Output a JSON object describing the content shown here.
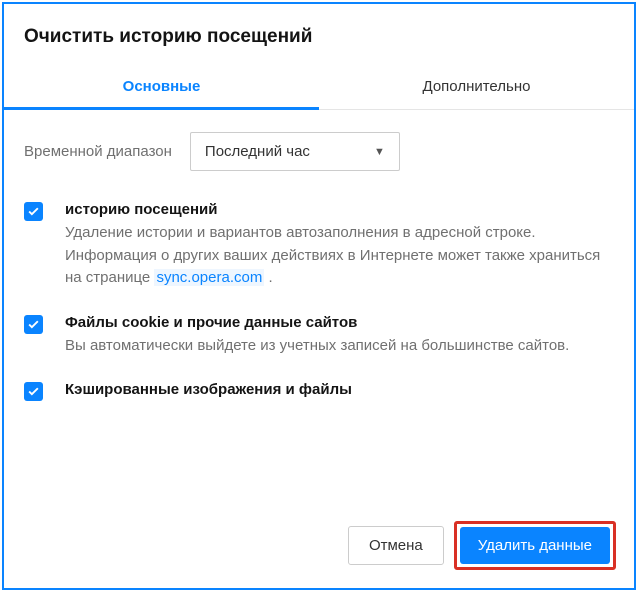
{
  "title": "Очистить историю посещений",
  "tabs": {
    "basic": "Основные",
    "advanced": "Дополнительно"
  },
  "timeRange": {
    "label": "Временной диапазон",
    "selected": "Последний час"
  },
  "options": [
    {
      "title": "историю посещений",
      "desc_before": "Удаление истории и вариантов автозаполнения в адресной строке. Информация о других ваших действиях в Интернете может также храниться на странице ",
      "link": "sync.opera.com",
      "desc_after": " ."
    },
    {
      "title": "Файлы cookie и прочие данные сайтов",
      "desc": "Вы автоматически выйдете из учетных записей на большинстве сайтов."
    },
    {
      "title": "Кэшированные изображения и файлы",
      "desc": ""
    }
  ],
  "buttons": {
    "cancel": "Отмена",
    "confirm": "Удалить данные"
  }
}
